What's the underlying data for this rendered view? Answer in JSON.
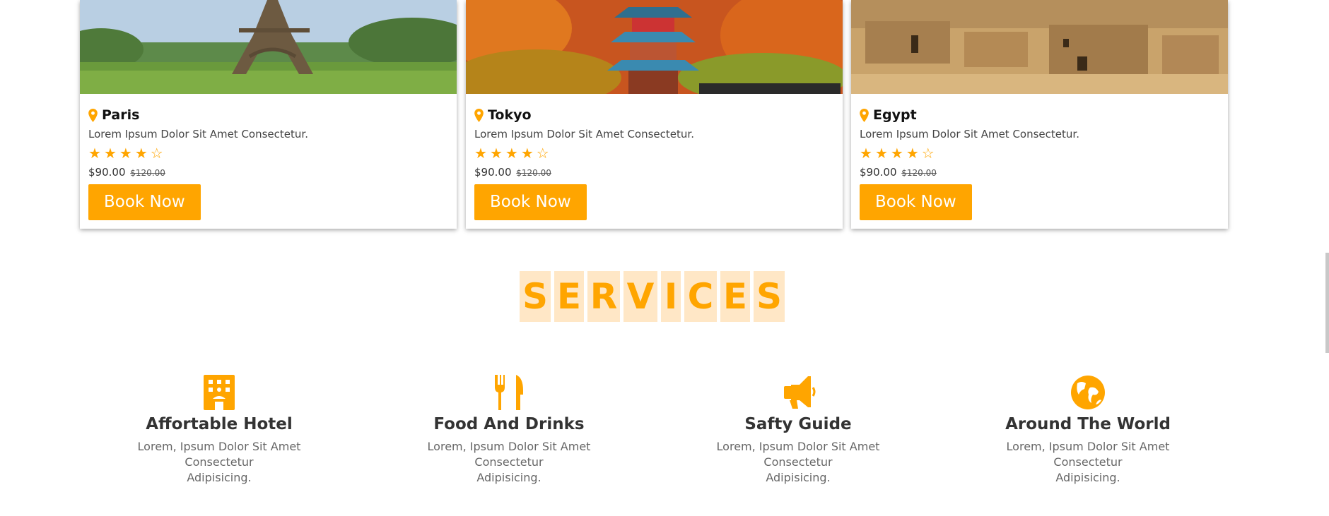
{
  "accent_color": "#ffa500",
  "cards": [
    {
      "title": "Paris",
      "description": "Lorem Ipsum Dolor Sit Amet Consectetur.",
      "rating": 4,
      "rating_max": 5,
      "price": "$90.00",
      "old_price": "$120.00",
      "button": "Book Now"
    },
    {
      "title": "Tokyo",
      "description": "Lorem Ipsum Dolor Sit Amet Consectetur.",
      "rating": 4,
      "rating_max": 5,
      "price": "$90.00",
      "old_price": "$120.00",
      "button": "Book Now"
    },
    {
      "title": "Egypt",
      "description": "Lorem Ipsum Dolor Sit Amet Consectetur.",
      "rating": 4,
      "rating_max": 5,
      "price": "$90.00",
      "old_price": "$120.00",
      "button": "Book Now"
    }
  ],
  "services": {
    "heading_letters": [
      "S",
      "E",
      "R",
      "V",
      "I",
      "C",
      "E",
      "S"
    ],
    "items": [
      {
        "icon": "hotel-icon",
        "name": "Affortable Hotel",
        "line1": "Lorem, Ipsum Dolor Sit Amet Consectetur",
        "line2": "Adipisicing."
      },
      {
        "icon": "utensils-icon",
        "name": "Food And Drinks",
        "line1": "Lorem, Ipsum Dolor Sit Amet Consectetur",
        "line2": "Adipisicing."
      },
      {
        "icon": "bullhorn-icon",
        "name": "Safty Guide",
        "line1": "Lorem, Ipsum Dolor Sit Amet Consectetur",
        "line2": "Adipisicing."
      },
      {
        "icon": "globe-icon",
        "name": "Around The World",
        "line1": "Lorem, Ipsum Dolor Sit Amet Consectetur",
        "line2": "Adipisicing."
      }
    ]
  }
}
